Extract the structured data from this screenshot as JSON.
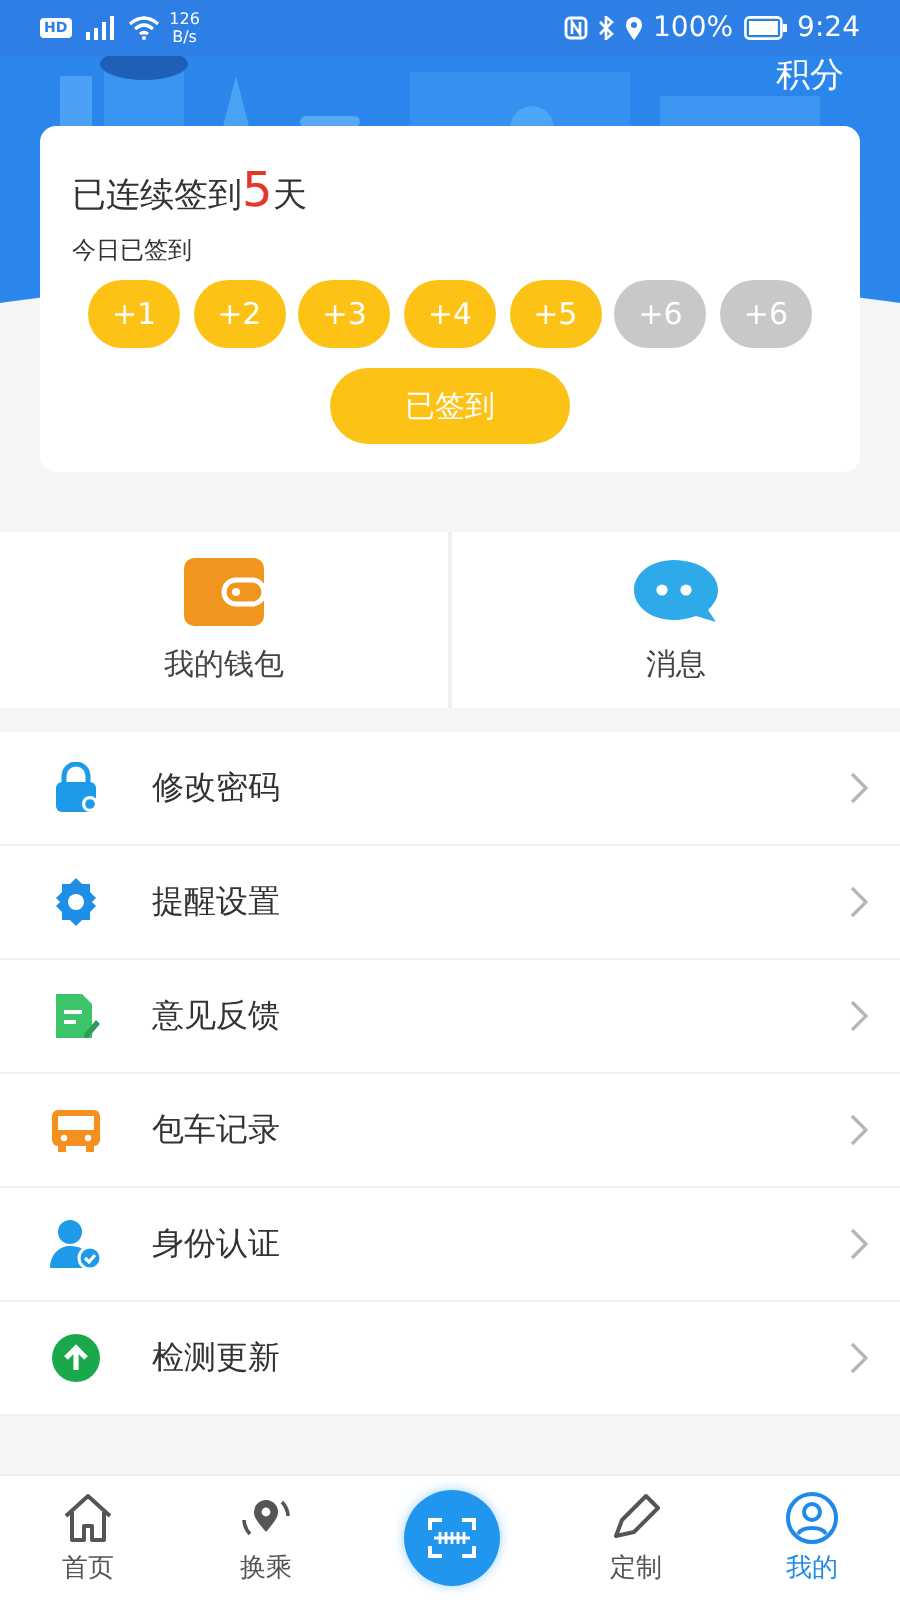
{
  "status_bar": {
    "hd": "HD",
    "network": "126\nB/s",
    "battery": "100%",
    "time": "9:24"
  },
  "header": {
    "title": "积分"
  },
  "checkin": {
    "streak_prefix": "已连续签到",
    "streak_days": "5",
    "streak_suffix": "天",
    "today_label": "今日已签到",
    "days": [
      {
        "label": "+1",
        "checked": true
      },
      {
        "label": "+2",
        "checked": true
      },
      {
        "label": "+3",
        "checked": true
      },
      {
        "label": "+4",
        "checked": true
      },
      {
        "label": "+5",
        "checked": true
      },
      {
        "label": "+6",
        "checked": false
      },
      {
        "label": "+6",
        "checked": false
      }
    ],
    "button": "已签到"
  },
  "tiles": [
    {
      "kind": "wallet",
      "label": "我的钱包"
    },
    {
      "kind": "message",
      "label": "消息"
    }
  ],
  "menu": [
    {
      "kind": "lock",
      "label": "修改密码"
    },
    {
      "kind": "gear",
      "label": "提醒设置"
    },
    {
      "kind": "document",
      "label": "意见反馈"
    },
    {
      "kind": "bus",
      "label": "包车记录"
    },
    {
      "kind": "person",
      "label": "身份认证"
    },
    {
      "kind": "update",
      "label": "检测更新"
    }
  ],
  "tab_bar": [
    {
      "kind": "home",
      "label": "首页",
      "selected": false
    },
    {
      "kind": "transfer",
      "label": "换乘",
      "selected": false
    },
    {
      "kind": "scan"
    },
    {
      "kind": "custom",
      "label": "定制",
      "selected": false
    },
    {
      "kind": "profile",
      "label": "我的",
      "selected": true
    }
  ]
}
